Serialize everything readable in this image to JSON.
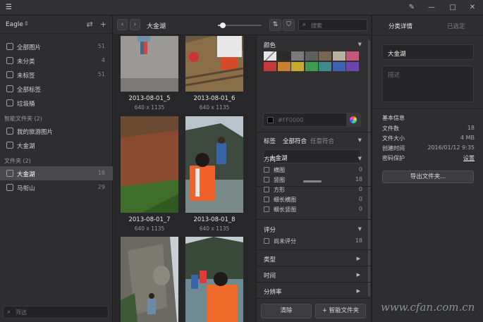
{
  "sidebar": {
    "library_name": "Eagle",
    "items": [
      {
        "label": "全部图片",
        "count": "51"
      },
      {
        "label": "未分类",
        "count": "4"
      },
      {
        "label": "未标签",
        "count": "51"
      },
      {
        "label": "全部标签",
        "count": ""
      },
      {
        "label": "垃圾桶",
        "count": ""
      }
    ],
    "smart_title": "智能文件夹 (2)",
    "smart_items": [
      {
        "label": "我的旅游图片"
      },
      {
        "label": "大金湖"
      }
    ],
    "folders_title": "文件夹 (2)",
    "folders": [
      {
        "label": "大金湖",
        "count": "18"
      },
      {
        "label": "马衔山",
        "count": "29"
      }
    ],
    "filter_placeholder": "筛选"
  },
  "toolbar": {
    "breadcrumb": "大金湖",
    "search_placeholder": "搜索",
    "thumb_size_level": 0.12
  },
  "grid": {
    "items": [
      {
        "name": "2013-08-01_5",
        "dims": "640 x 1135"
      },
      {
        "name": "2013-08-01_6",
        "dims": "640 x 1135"
      },
      {
        "name": "2013-08-01_7",
        "dims": "640 x 1135"
      },
      {
        "name": "2013-08-01_8",
        "dims": "640 x 1135"
      },
      {
        "name": "",
        "dims": ""
      },
      {
        "name": "",
        "dims": ""
      }
    ]
  },
  "filter": {
    "color_title": "颜色",
    "colors": [
      "#e6e6e6",
      "#2a2a2a",
      "#7a7a7a",
      "#5f5f5f",
      "#7a6452",
      "#b8b29a",
      "#c2587a",
      "#c33a3a",
      "#c8822f",
      "#c8a82f",
      "#3f9a52",
      "#3e8a88",
      "#3c62b0",
      "#6c46b0"
    ],
    "hex_placeholder": "#FF0000",
    "tag_title": "标签",
    "tag_mode_all": "全部符合",
    "tag_mode_any": "任意符合",
    "tag_value": "大金湖",
    "orientation_title": "方向",
    "orientation": [
      {
        "label": "横图",
        "count": "0"
      },
      {
        "label": "竖图",
        "count": "18"
      },
      {
        "label": "方形",
        "count": "0"
      },
      {
        "label": "细长横图",
        "count": "0"
      },
      {
        "label": "细长竖图",
        "count": "0"
      }
    ],
    "rating_title": "评分",
    "rating": [
      {
        "label": "尚未评分",
        "count": "18"
      }
    ],
    "type_title": "类型",
    "time_title": "时间",
    "resolution_title": "分辨率",
    "clear_label": "清除",
    "smart_folder_label": "+ 智能文件夹"
  },
  "details": {
    "tab_details": "分类详情",
    "tab_selected": "已选定",
    "name_value": "大金湖",
    "desc_placeholder": "描述",
    "info_title": "基本信息",
    "rows": [
      {
        "key": "文件数",
        "value": "18"
      },
      {
        "key": "文件大小",
        "value": "4 MB"
      },
      {
        "key": "创建时间",
        "value": "2016/01/12 9:35"
      },
      {
        "key": "密码保护",
        "value": "设置"
      }
    ],
    "export_label": "导出文件夹..."
  },
  "watermark": "www.cfan.com.cn"
}
